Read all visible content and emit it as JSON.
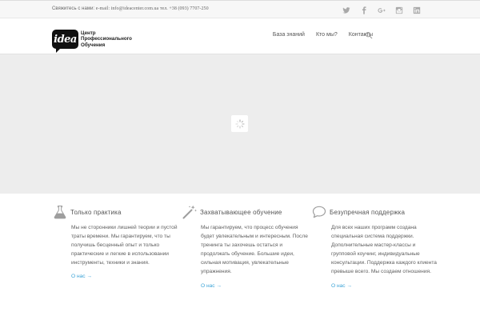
{
  "topbar": {
    "contact_label": "Свяжитесь с нами:",
    "contact_email": "e-mail: info@ideacenter.com.ua",
    "contact_phone": "тел. +38 (093) 7707-250",
    "socials": [
      "twitter-icon",
      "facebook-icon",
      "google-plus-icon",
      "instagram-icon",
      "linkedin-icon"
    ]
  },
  "logo": {
    "mark": "idea",
    "line1": "Центр",
    "line2": "Профессионального",
    "line3": "Обучения"
  },
  "nav": {
    "items": [
      "База знаний",
      "Кто мы?",
      "Контакты"
    ]
  },
  "features": [
    {
      "icon": "flask-icon",
      "title": "Только практика",
      "text": "Мы не сторонники лишней теории и пустой траты времени. Мы гарантируем, что ты получишь бесценный опыт и только практические и легкие в использовании инструменты, техники и знания.",
      "more": "О нас →"
    },
    {
      "icon": "magic-wand-icon",
      "title": "Захватывающее обучение",
      "text": "Мы гарантируем, что процесс обучения будет увлекательным и интересным. После тренинга ты захочешь остаться и продолжать обучение. Большие идеи, сильная мотивация, увлекательные упражнения.",
      "more": "О нас →"
    },
    {
      "icon": "speech-bubble-icon",
      "title": "Безупречная поддержка",
      "text": "Для всех наших программ создана специальная система поддержки. Дополнительные мастер-классы и групповой коучинг, индивидуальные консультации. Поддержка каждого клиента превыше всего. Мы создаем отношения.",
      "more": "О нас →"
    }
  ],
  "colors": {
    "link": "#3aa2d6",
    "slider_bg": "#ededed",
    "icon_gray": "#a9a9a9"
  }
}
